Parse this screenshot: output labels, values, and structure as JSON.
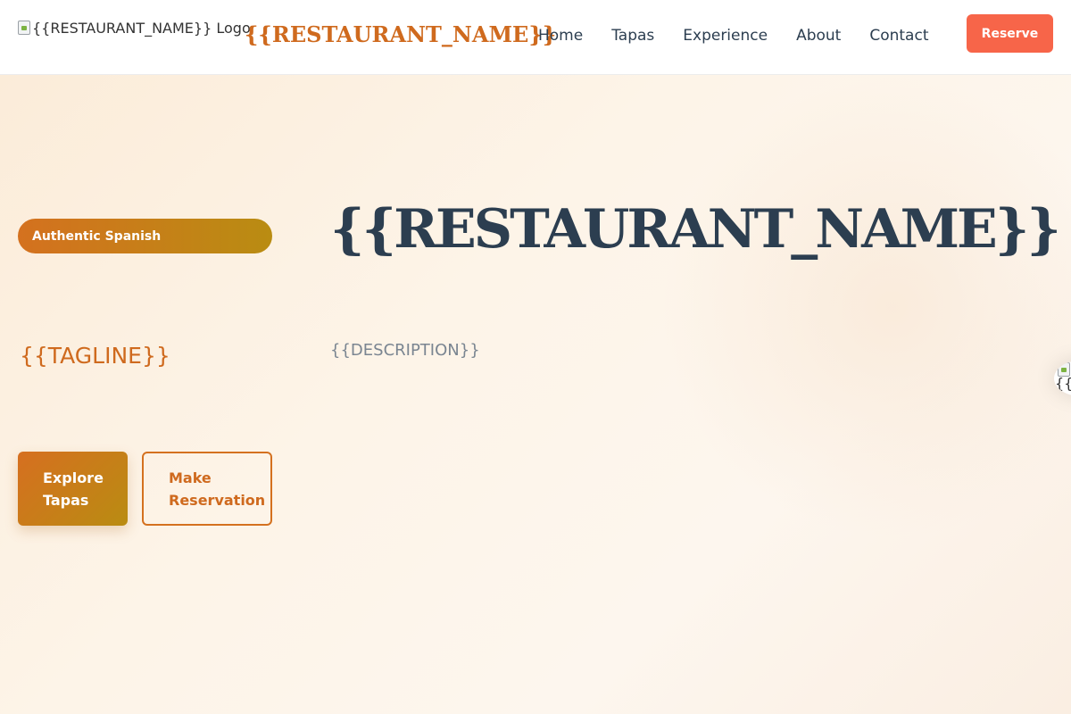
{
  "header": {
    "logo_alt": "{{RESTAURANT_NAME}} Logo",
    "brand_name": "{{RESTAURANT_NAME}}",
    "nav": [
      "Home",
      "Tapas",
      "Experience",
      "About",
      "Contact"
    ],
    "reserve_label": "Reserve"
  },
  "hero": {
    "badge": "Authentic Spanish",
    "title": "{{RESTAURANT_NAME}}",
    "tagline": "{{TAGLINE}}",
    "description": "{{DESCRIPTION}}",
    "primary_button": "Explore Tapas",
    "secondary_button": "Make Reservation",
    "image_alt": "{{R"
  },
  "colors": {
    "accent": "#cf6a1e",
    "reserve": "#f76549",
    "heading": "#2c3e50"
  },
  "icons": [
    "broken-image-icon"
  ]
}
